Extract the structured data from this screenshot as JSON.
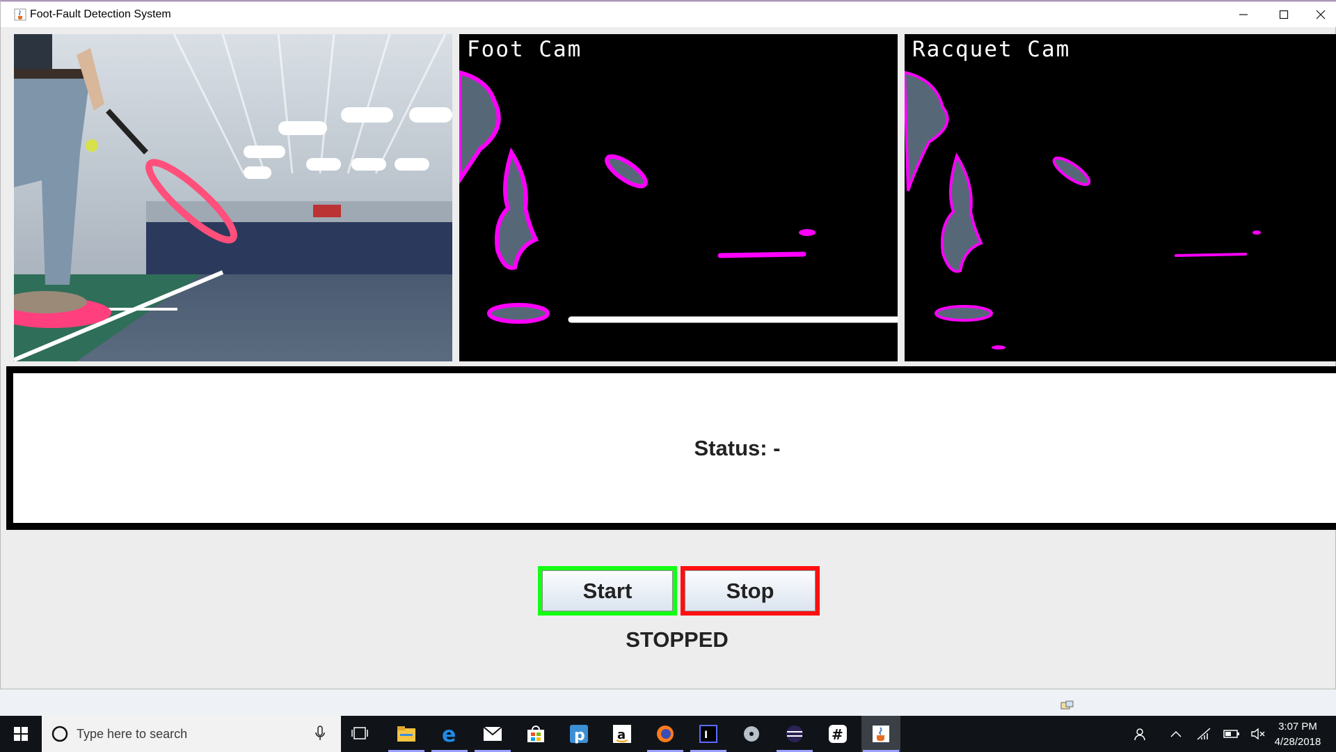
{
  "window": {
    "title": "Foot-Fault Detection System"
  },
  "cameras": {
    "foot_cam_label": "Foot Cam",
    "racquet_cam_label": "Racquet Cam"
  },
  "status": {
    "text": "Status: -"
  },
  "controls": {
    "start_label": "Start",
    "stop_label": "Stop",
    "run_state": "STOPPED",
    "start_border_color": "#13ff13",
    "stop_border_color": "#ff1010"
  },
  "colors": {
    "mask_outline": "#ff00ff",
    "mask_fill": "#566878"
  },
  "taskbar": {
    "search_placeholder": "Type here to search",
    "apps": [
      "file-explorer",
      "edge",
      "mail",
      "store",
      "pandora",
      "amazon",
      "firefox",
      "intellij",
      "app-disc",
      "eclipse",
      "slack",
      "java"
    ],
    "clock_time": "3:07 PM",
    "clock_date": "4/28/2018"
  }
}
